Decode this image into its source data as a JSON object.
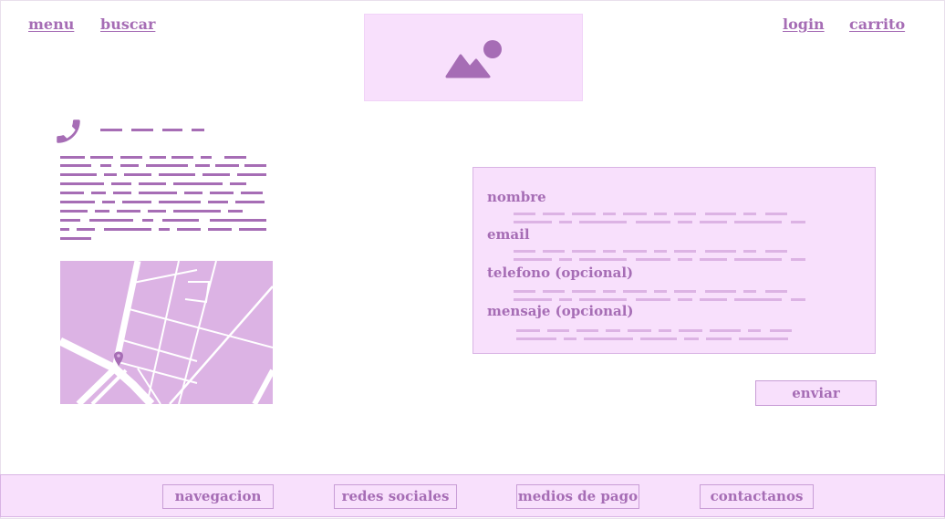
{
  "header": {
    "menu_label": "menu",
    "search_label": "buscar",
    "login_label": "login",
    "cart_label": "carrito",
    "logo_icon": "image-placeholder-icon"
  },
  "contact": {
    "phone_icon": "phone-icon",
    "map_marker_icon": "map-pin-icon"
  },
  "form": {
    "name_label": "nombre",
    "email_label": "email",
    "phone_label": "telefono (opcional)",
    "message_label": "mensaje (opcional)",
    "submit_label": "enviar"
  },
  "footer": {
    "links": [
      {
        "label": "navegacion"
      },
      {
        "label": "redes sociales"
      },
      {
        "label": "medios de pago"
      },
      {
        "label": "contactanos"
      }
    ]
  },
  "colors": {
    "accent": "#a66db5",
    "panel": "#f8e0fc",
    "map_fill": "#dcb3e4",
    "placeholder_line": "#dcb3e4"
  }
}
